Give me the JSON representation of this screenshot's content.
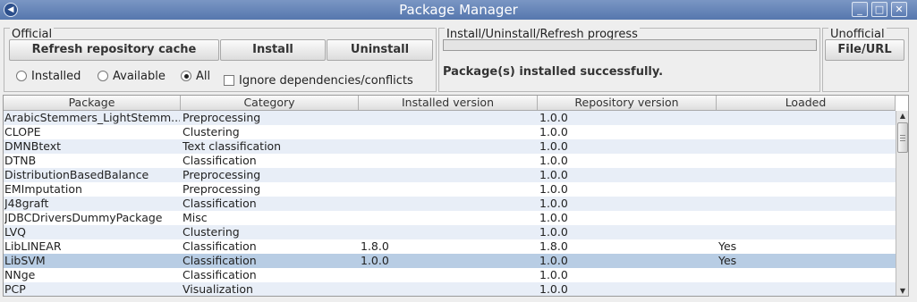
{
  "window": {
    "title": "Package Manager",
    "controls": [
      "_",
      "□",
      "✕"
    ]
  },
  "official": {
    "title": "Official",
    "refresh_label": "Refresh repository cache",
    "install_label": "Install",
    "uninstall_label": "Uninstall",
    "filters": {
      "installed": "Installed",
      "available": "Available",
      "all": "All",
      "selected": "All"
    },
    "ignore_deps_label": "Ignore dependencies/conflicts",
    "ignore_deps_checked": false
  },
  "progress": {
    "title": "Install/Uninstall/Refresh progress",
    "value": 0,
    "message": "Package(s) installed successfully."
  },
  "unofficial": {
    "title": "Unofficial",
    "file_url_label": "File/URL"
  },
  "table": {
    "columns": [
      "Package",
      "Category",
      "Installed version",
      "Repository version",
      "Loaded"
    ],
    "selected_row": 10,
    "rows": [
      [
        "ArabicStemmers_LightStemm...",
        "Preprocessing",
        "",
        "1.0.0",
        ""
      ],
      [
        "CLOPE",
        "Clustering",
        "",
        "1.0.0",
        ""
      ],
      [
        "DMNBtext",
        "Text classification",
        "",
        "1.0.0",
        ""
      ],
      [
        "DTNB",
        "Classification",
        "",
        "1.0.0",
        ""
      ],
      [
        "DistributionBasedBalance",
        "Preprocessing",
        "",
        "1.0.0",
        ""
      ],
      [
        "EMImputation",
        "Preprocessing",
        "",
        "1.0.0",
        ""
      ],
      [
        "J48graft",
        "Classification",
        "",
        "1.0.0",
        ""
      ],
      [
        "JDBCDriversDummyPackage",
        "Misc",
        "",
        "1.0.0",
        ""
      ],
      [
        "LVQ",
        "Clustering",
        "",
        "1.0.0",
        ""
      ],
      [
        "LibLINEAR",
        "Classification",
        "1.8.0",
        "1.8.0",
        "Yes"
      ],
      [
        "LibSVM",
        "Classification",
        "1.0.0",
        "1.0.0",
        "Yes"
      ],
      [
        "NNge",
        "Classification",
        "",
        "1.0.0",
        ""
      ],
      [
        "PCP",
        "Visualization",
        "",
        "1.0.0",
        ""
      ]
    ]
  }
}
